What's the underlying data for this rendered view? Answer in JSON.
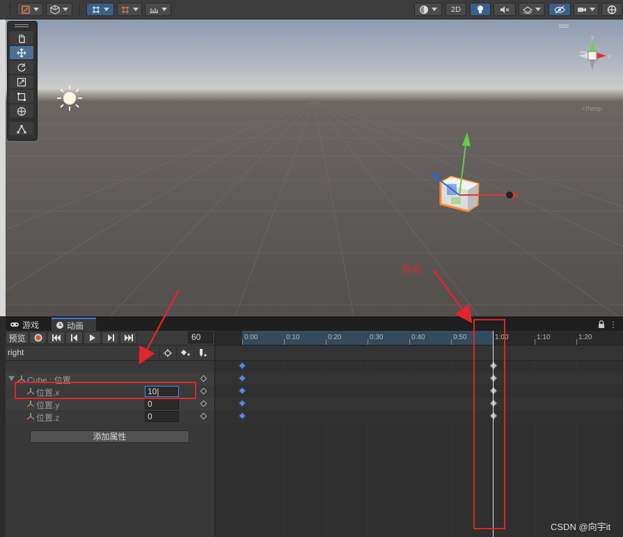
{
  "toolbar": {
    "mode_2d": "2D"
  },
  "panel": {
    "tabs": [
      {
        "label": "游戏",
        "icon": "gamepad-icon"
      },
      {
        "label": "动画",
        "icon": "clock-icon"
      }
    ]
  },
  "animation": {
    "preview_label": "预览",
    "frame_value": "60",
    "clip_name": "right",
    "add_property_label": "添加属性",
    "properties": [
      {
        "label": "Cube : 位置",
        "value": null
      },
      {
        "label": "位置.x",
        "value": "10"
      },
      {
        "label": "位置.y",
        "value": "0"
      },
      {
        "label": "位置.z",
        "value": "0"
      }
    ]
  },
  "timeline": {
    "ticks": [
      "0:00",
      "0:10",
      "0:20",
      "0:30",
      "0:40",
      "0:50",
      "1:00",
      "1:10",
      "1:20"
    ],
    "playhead_time": "1:00"
  },
  "scene": {
    "persp_label": "<Persp",
    "gizmo_axes": [
      "y",
      "x"
    ]
  },
  "annotation": {
    "label": "拖动"
  },
  "watermark": "CSDN @向宇it",
  "colors": {
    "accent": "#3d7be0",
    "annotation_red": "#e0262b",
    "key_blue": "#5b8ad6"
  }
}
